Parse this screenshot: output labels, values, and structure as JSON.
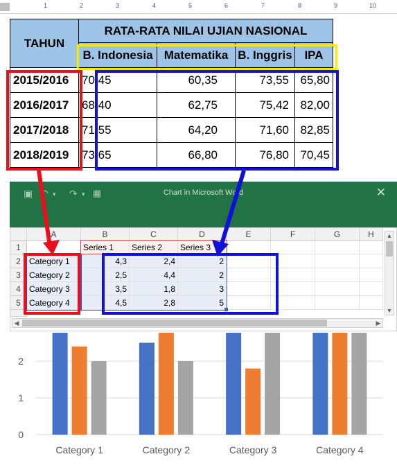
{
  "ruler": {
    "numbers": [
      "1",
      "2",
      "3",
      "4",
      "5",
      "6",
      "7",
      "8",
      "9",
      "10"
    ]
  },
  "word_table": {
    "year_header": "TAHUN",
    "group_header": "RATA-RATA NILAI UJIAN NASIONAL",
    "subjects": [
      "B. Indonesia",
      "Matematika",
      "B. Inggris",
      "IPA"
    ],
    "rows": [
      {
        "year": "2015/2016",
        "values": [
          "70,45",
          "60,35",
          "73,55",
          "65,80"
        ]
      },
      {
        "year": "2016/2017",
        "values": [
          "68,40",
          "62,75",
          "75,42",
          "82,00"
        ]
      },
      {
        "year": "2017/2018",
        "values": [
          "71,55",
          "64,20",
          "71,60",
          "82,85"
        ]
      },
      {
        "year": "2018/2019",
        "values": [
          "73,65",
          "66,80",
          "76,80",
          "70,45"
        ]
      }
    ]
  },
  "excel": {
    "title": "Chart in Microsoft Word",
    "close_glyph": "✕",
    "columns": [
      "A",
      "B",
      "C",
      "D",
      "E",
      "F",
      "G",
      "H"
    ],
    "row_numbers": [
      "1",
      "2",
      "3",
      "4",
      "5"
    ],
    "header_row": [
      "",
      "Series 1",
      "Series 2",
      "Series 3"
    ],
    "data_rows": [
      {
        "category": "Category 1",
        "values": [
          "4,3",
          "2,4",
          "2"
        ]
      },
      {
        "category": "Category 2",
        "values": [
          "2,5",
          "4,4",
          "2"
        ]
      },
      {
        "category": "Category 3",
        "values": [
          "3,5",
          "1,8",
          "3"
        ]
      },
      {
        "category": "Category 4",
        "values": [
          "4,5",
          "2,8",
          "5"
        ]
      }
    ]
  },
  "colors": {
    "red_box": "#e8101a",
    "blue_box": "#1010d8",
    "yellow_box": "#f5ec00",
    "header_fill": "#9dc3e6",
    "excel_green": "#217346",
    "series": [
      "#4472c4",
      "#ed7d31",
      "#a5a5a5"
    ]
  },
  "chart_data": {
    "type": "bar",
    "categories": [
      "Category 1",
      "Category 2",
      "Category 3",
      "Category 4"
    ],
    "series": [
      {
        "name": "Series 1",
        "values": [
          4.3,
          2.5,
          3.5,
          4.5
        ]
      },
      {
        "name": "Series 2",
        "values": [
          2.4,
          4.4,
          1.8,
          2.8
        ]
      },
      {
        "name": "Series 3",
        "values": [
          2,
          2,
          3,
          5
        ]
      }
    ],
    "yticks": [
      "0",
      "1",
      "2"
    ],
    "ylim_visible": [
      0,
      2.75
    ],
    "grid": true
  }
}
